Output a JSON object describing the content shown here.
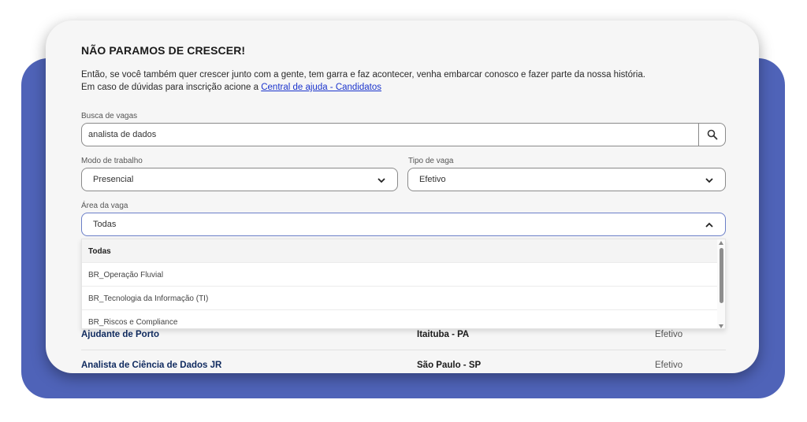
{
  "page": {
    "title": "NÃO PARAMOS DE CRESCER!",
    "intro_line1": "Então, se você também quer crescer junto com a gente, tem garra e faz acontecer, venha embarcar conosco e fazer parte da nossa história.",
    "intro_line2_prefix": "Em caso de dúvidas para inscrição acione a ",
    "help_link": "Central de ajuda - Candidatos"
  },
  "search": {
    "label": "Busca de vagas",
    "value": "analista de dados",
    "icon": "search-icon"
  },
  "filters": {
    "work_mode": {
      "label": "Modo de trabalho",
      "value": "Presencial"
    },
    "job_type": {
      "label": "Tipo de vaga",
      "value": "Efetivo"
    },
    "area": {
      "label": "Área da vaga",
      "value": "Todas",
      "options": [
        "Todas",
        "BR_Operação Fluvial",
        "BR_Tecnologia da Informação (TI)",
        "BR_Riscos e Compliance"
      ]
    }
  },
  "jobs": [
    {
      "title": "Ajudante de Porto",
      "location": "Itaituba - PA",
      "type": "Efetivo"
    },
    {
      "title": "Analista de Ciência de Dados JR",
      "location": "São Paulo - SP",
      "type": "Efetivo"
    }
  ],
  "colors": {
    "background_blob": "#4f63b8",
    "card": "#f6f6f6",
    "link": "#1a33cc",
    "job_title": "#0f2a5f"
  }
}
